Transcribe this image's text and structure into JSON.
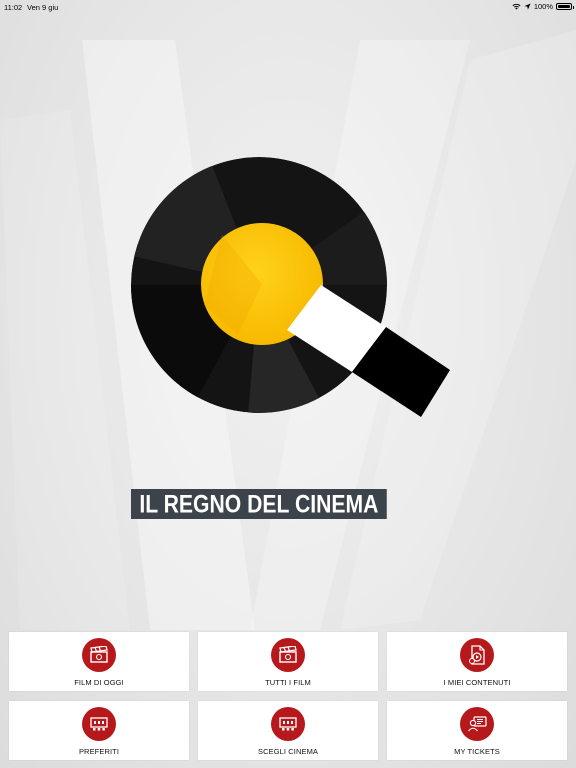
{
  "status_bar": {
    "time": "11:02",
    "date": "Ven 9 giu",
    "battery": "100%"
  },
  "brand": {
    "title": "IL REGNO DEL CINEMA"
  },
  "colors": {
    "accent_red": "#b5191b",
    "logo_yellow": "#fcc200",
    "banner_bg": "#3d434a"
  },
  "menu": [
    {
      "label": "FILM DI OGGI",
      "icon": "clapperboard-icon"
    },
    {
      "label": "TUTTI I FILM",
      "icon": "clapperboard-icon"
    },
    {
      "label": "I MIEI CONTENUTI",
      "icon": "media-file-icon"
    },
    {
      "label": "PREFERITI",
      "icon": "cinema-screen-icon"
    },
    {
      "label": "SCEGLI CINEMA",
      "icon": "cinema-screen-icon"
    },
    {
      "label": "MY TICKETS",
      "icon": "ticket-user-icon"
    }
  ]
}
